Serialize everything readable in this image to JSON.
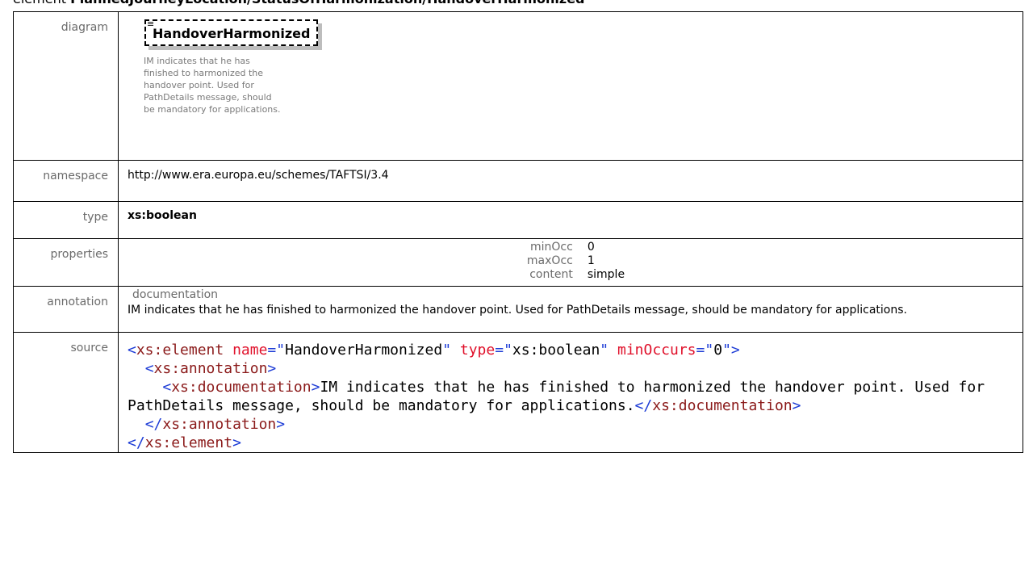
{
  "heading": {
    "prefix": "element ",
    "path": "PlannedJourneyLocation/StatusOfHarmonization/HandoverHarmonized"
  },
  "rows": {
    "diagram": {
      "label": "diagram",
      "element_name": "HandoverHarmonized",
      "doc_lines": [
        "IM indicates that he has",
        "finished to harmonized the",
        "handover point. Used for",
        "PathDetails message, should",
        "be mandatory for applications."
      ]
    },
    "namespace": {
      "label": "namespace",
      "value": "http://www.era.europa.eu/schemes/TAFTSI/3.4"
    },
    "type": {
      "label": "type",
      "value": "xs:boolean"
    },
    "properties": {
      "label": "properties",
      "items": [
        {
          "key": "minOcc",
          "value": "0"
        },
        {
          "key": "maxOcc",
          "value": "1"
        },
        {
          "key": "content",
          "value": "simple"
        }
      ]
    },
    "annotation": {
      "label": "annotation",
      "key": "documentation",
      "text": "IM indicates that he has finished to harmonized the handover point. Used for PathDetails message, should be mandatory for applications."
    },
    "source": {
      "label": "source",
      "element_tag": "xs:element",
      "attr_name": "name",
      "attr_name_value": "HandoverHarmonized",
      "attr_type": "type",
      "attr_type_value": "xs:boolean",
      "attr_min": "minOccurs",
      "attr_min_value": "0",
      "annotation_tag": "xs:annotation",
      "documentation_tag": "xs:documentation",
      "documentation_text": "IM indicates that he has finished to harmonized the handover point. Used for PathDetails message, should be mandatory for applications."
    }
  },
  "colors": {
    "tag": "#1d3cd6",
    "tag_name": "#8b1a1a",
    "attr_name": "#e0102a",
    "label_text": "#6b6b6b",
    "diagram_doc_text": "#7a7a7a"
  }
}
